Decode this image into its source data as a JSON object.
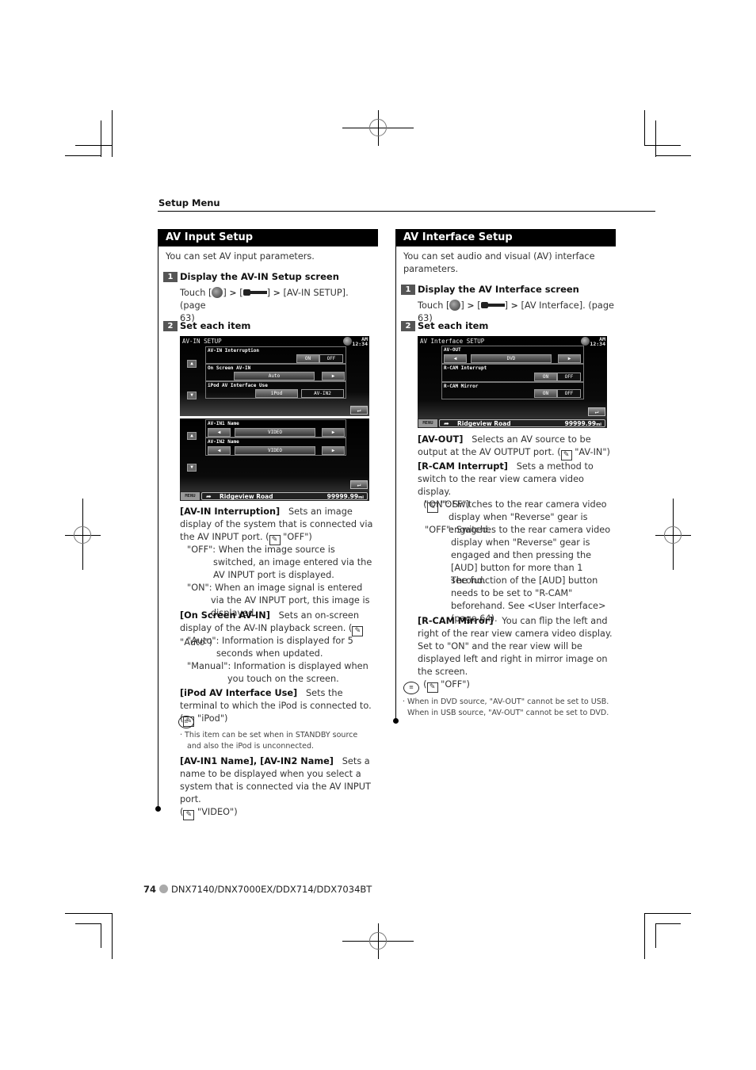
{
  "header": {
    "section": "Setup Menu"
  },
  "left": {
    "title": "AV Input Setup",
    "intro": "You can set AV input parameters.",
    "step1": {
      "num": "1",
      "title": "Display the AV-IN Setup screen",
      "touch": "Touch [",
      "mid1": "] ",
      "mid2": " [",
      "mid3": "] ",
      "target": " [AV-IN SETUP]. (page",
      "page_tail": "63)"
    },
    "step2": {
      "num": "2",
      "title": "Set each item"
    },
    "screen1": {
      "title": "AV-IN SETUP",
      "clock_am": "AM",
      "clock_time": "12:34",
      "rows": [
        {
          "label": "AV-IN Interruption",
          "options": [
            "ON",
            "OFF"
          ],
          "selected": "ON"
        },
        {
          "label": "On Screen AV-IN",
          "value": "Auto"
        },
        {
          "label": "iPod AV Interface Use",
          "options": [
            "iPod",
            "AV-IN2"
          ],
          "selected": "iPod"
        }
      ]
    },
    "screen2": {
      "rows": [
        {
          "label": "AV-IN1 Name",
          "value": "VIDEO"
        },
        {
          "label": "AV-IN2 Name",
          "value": "VIDEO"
        }
      ],
      "menu": "MENU",
      "road": "Ridgeview Road",
      "distance": "99999.99",
      "unit": "mi"
    },
    "items": [
      {
        "name": "[AV-IN Interruption]",
        "desc": "Sets an image display of the system that is connected via the AV INPUT port. (",
        "default": " \"OFF\")",
        "sub": [
          {
            "key": "\"OFF\":",
            "text": "When the image source is switched, an image entered via the AV INPUT port is displayed."
          },
          {
            "key": "\"ON\":",
            "text": "When an image signal is entered via the AV INPUT port, this image is displayed."
          }
        ]
      },
      {
        "name": "[On Screen AV-IN]",
        "desc": "Sets an on-screen display of the AV-IN playback screen. (",
        "default": " \"Auto\")",
        "sub": [
          {
            "key": "\"Auto\":",
            "text": "Information is displayed for 5 seconds when updated."
          },
          {
            "key": "\"Manual\":",
            "text": "Information is displayed when you touch on the screen."
          }
        ]
      },
      {
        "name": "[iPod AV Interface Use]",
        "desc": "Sets the terminal to which the iPod is connected to. (",
        "default": " \"iPod\")"
      },
      {
        "name": "[AV-IN1 Name], [AV-IN2 Name]",
        "desc": "Sets a name to be displayed when you select a system that is connected via the AV INPUT port.",
        "default": " \"VIDEO\")"
      }
    ],
    "note": "This item can be set when in STANDBY source and also the iPod is unconnected."
  },
  "right": {
    "title": "AV Interface Setup",
    "intro": "You can set audio and visual (AV) interface parameters.",
    "step1": {
      "num": "1",
      "title": "Display the AV Interface screen",
      "touch": "Touch [",
      "target": " [AV Interface]. (page 63)"
    },
    "step2": {
      "num": "2",
      "title": "Set each item"
    },
    "screen": {
      "title": "AV Interface SETUP",
      "clock_am": "AM",
      "clock_time": "12:34",
      "rows": [
        {
          "label": "AV-OUT",
          "value": "DVD"
        },
        {
          "label": "R-CAM Interrupt",
          "options": [
            "ON",
            "OFF"
          ],
          "selected": "ON"
        },
        {
          "label": "R-CAM Mirror",
          "options": [
            "ON",
            "OFF"
          ],
          "selected": "ON"
        }
      ],
      "menu": "MENU",
      "road": "Ridgeview Road",
      "distance": "99999.99",
      "unit": "mi"
    },
    "items": [
      {
        "name": "[AV-OUT]",
        "desc": "Selects an AV source to be output at the AV OUTPUT port. (",
        "default": " \"AV-IN\")"
      },
      {
        "name": "[R-CAM Interrupt]",
        "desc": "Sets a method to switch to the rear view camera video display.",
        "default": " \"OFF\")",
        "sub": [
          {
            "key": "\"ON\":",
            "text": "Switches to the rear camera video display when \"Reverse\" gear is engaged."
          },
          {
            "key": "\"OFF\":",
            "text": "Switches to the rear camera video display when \"Reverse\" gear is engaged and then pressing the [AUD] button for more than 1 second."
          },
          {
            "key": "",
            "text": "The function of the [AUD] button needs to be set to \"R-CAM\" beforehand.  See <User Interface> (page 64)."
          }
        ]
      },
      {
        "name": "[R-CAM Mirror]",
        "desc": "You can flip the left and right of the rear view camera video display. Set to \"ON\" and the rear view will be displayed left and right in mirror image on the screen.",
        "default": " \"OFF\")"
      }
    ],
    "notes": [
      "When in DVD source, \"AV-OUT\" cannot be set to USB.",
      "When in USB source, \"AV-OUT\" cannot be set to DVD."
    ]
  },
  "footer": {
    "page": "74",
    "models": "DNX7140/DNX7000EX/DDX714/DDX7034BT"
  },
  "icons": {
    "default_marker": "pencil-icon",
    "note_marker": "speech-bubble-icon",
    "home": "home-icon",
    "setup": "wrench-icon"
  }
}
